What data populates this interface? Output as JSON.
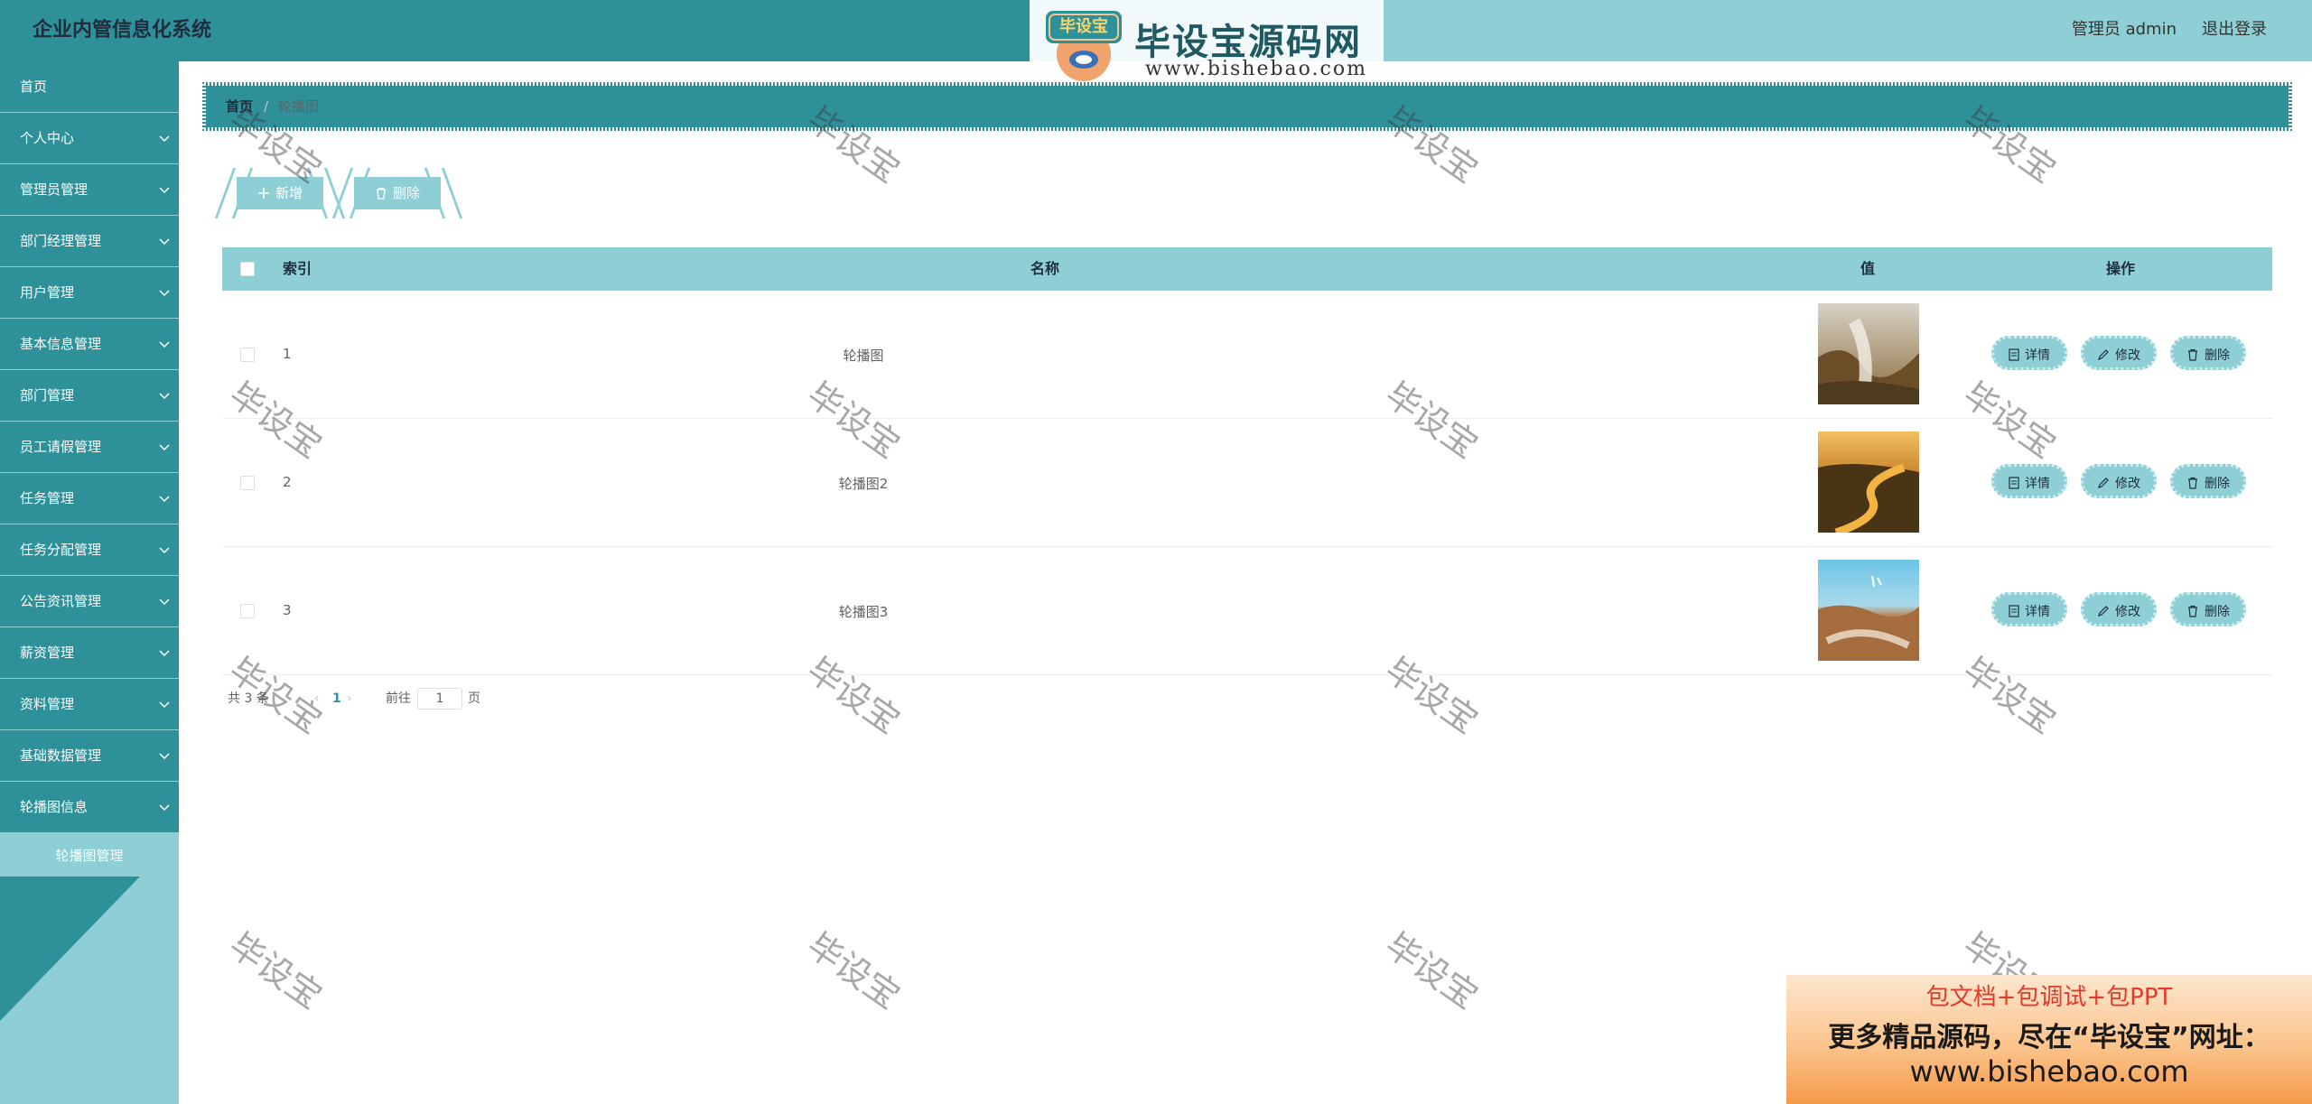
{
  "header": {
    "app_title": "企业内管信息化系统",
    "user_label": "管理员 admin",
    "logout_label": "退出登录"
  },
  "logo": {
    "badge_text": "毕设宝",
    "name": "毕设宝源码网",
    "url": "www.bishebao.com"
  },
  "sidebar": {
    "items": [
      {
        "label": "首页",
        "has_children": false
      },
      {
        "label": "个人中心",
        "has_children": true
      },
      {
        "label": "管理员管理",
        "has_children": true
      },
      {
        "label": "部门经理管理",
        "has_children": true
      },
      {
        "label": "用户管理",
        "has_children": true
      },
      {
        "label": "基本信息管理",
        "has_children": true
      },
      {
        "label": "部门管理",
        "has_children": true
      },
      {
        "label": "员工请假管理",
        "has_children": true
      },
      {
        "label": "任务管理",
        "has_children": true
      },
      {
        "label": "任务分配管理",
        "has_children": true
      },
      {
        "label": "公告资讯管理",
        "has_children": true
      },
      {
        "label": "薪资管理",
        "has_children": true
      },
      {
        "label": "资料管理",
        "has_children": true
      },
      {
        "label": "基础数据管理",
        "has_children": true
      },
      {
        "label": "轮播图信息",
        "has_children": true
      }
    ],
    "sub_item": "轮播图管理"
  },
  "breadcrumb": {
    "home": "首页",
    "separator": "/",
    "current": "轮播图"
  },
  "toolbar": {
    "add_label": "新增",
    "delete_label": "删除"
  },
  "table": {
    "headers": {
      "index": "索引",
      "name": "名称",
      "value": "值",
      "actions": "操作"
    },
    "rows": [
      {
        "index": "1",
        "name": "轮播图",
        "image": "waterfall"
      },
      {
        "index": "2",
        "name": "轮播图2",
        "image": "river-sunset"
      },
      {
        "index": "3",
        "name": "轮播图3",
        "image": "canyon-sky"
      }
    ],
    "actions": {
      "detail": "详情",
      "edit": "修改",
      "delete": "删除"
    }
  },
  "pagination": {
    "total": "共 3 条",
    "current_page": "1",
    "goto_prefix": "前往",
    "goto_value": "1",
    "goto_suffix": "页"
  },
  "watermark": "毕设宝",
  "ad": {
    "line1": "包文档+包调试+包PPT",
    "line2": "更多精品源码，尽在“毕设宝”网址：",
    "line3": "www.bishebao.com"
  },
  "colors": {
    "primary_dark": "#2e9199",
    "primary_light": "#8ecfd6"
  }
}
